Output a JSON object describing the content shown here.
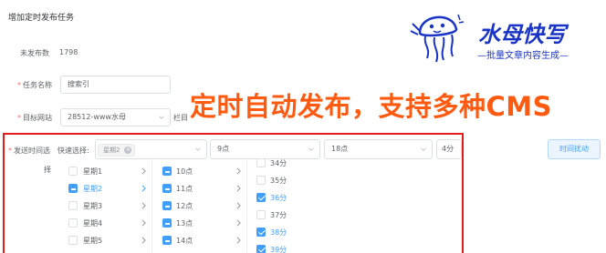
{
  "page": {
    "title": "增加定时发布任务"
  },
  "form": {
    "unpublished_label": "未发布数",
    "unpublished_value": "1798",
    "task_name_label": "任务名称",
    "task_name_value": "搜索引",
    "target_site_label": "目标网站",
    "target_site_value": "28512-www水母",
    "column_label_partial": "栏目",
    "schedule_label_line1": "发送时间选",
    "schedule_label_line2": "择",
    "quick_select_label": "快速选择:",
    "quick_select_tag": "星期2",
    "hour_start": "9点",
    "hour_end": "18点",
    "minute_interval": "4分",
    "time_perturb_button": "时间扰动"
  },
  "banner": {
    "text": "定时自动发布，支持多种CMS"
  },
  "logo": {
    "title": "水母快写",
    "subtitle": "—批量文章内容生成—"
  },
  "cascader": {
    "weekdays": [
      {
        "label": "星期1",
        "state": "unchecked",
        "active": false
      },
      {
        "label": "星期2",
        "state": "indeterminate",
        "active": true
      },
      {
        "label": "星期3",
        "state": "unchecked",
        "active": false
      },
      {
        "label": "星期4",
        "state": "unchecked",
        "active": false
      },
      {
        "label": "星期5",
        "state": "unchecked",
        "active": false
      }
    ],
    "hours": [
      {
        "label": "10点",
        "state": "indeterminate"
      },
      {
        "label": "11点",
        "state": "indeterminate"
      },
      {
        "label": "12点",
        "state": "indeterminate"
      },
      {
        "label": "13点",
        "state": "indeterminate"
      },
      {
        "label": "14点",
        "state": "indeterminate"
      }
    ],
    "minutes": [
      {
        "label": "34分",
        "state": "unchecked"
      },
      {
        "label": "35分",
        "state": "unchecked"
      },
      {
        "label": "36分",
        "state": "checked"
      },
      {
        "label": "37分",
        "state": "unchecked"
      },
      {
        "label": "38分",
        "state": "checked"
      },
      {
        "label": "39分",
        "state": "checked"
      }
    ]
  },
  "colors": {
    "accent": "#409eff",
    "banner": "#ff5a10",
    "frame": "#e51b1b",
    "logo": "#1a34c8"
  }
}
